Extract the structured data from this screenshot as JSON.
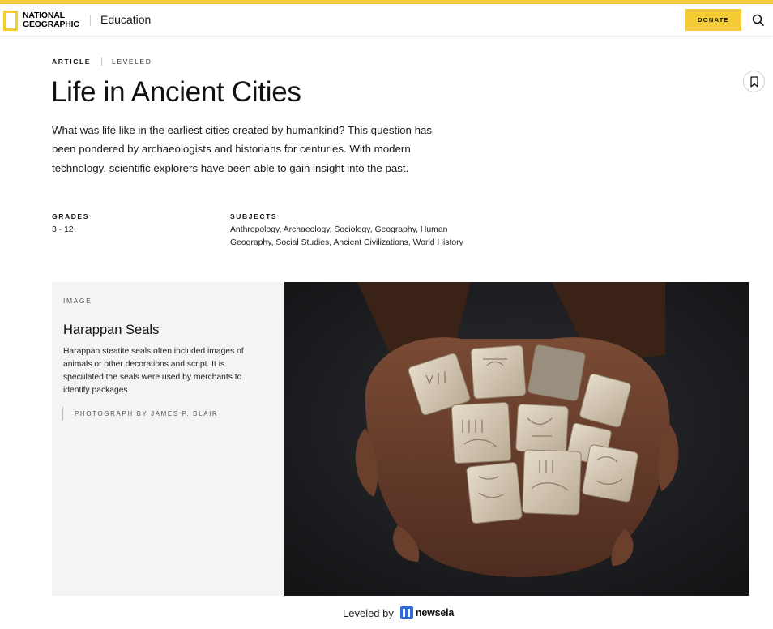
{
  "header": {
    "logo_line1": "NATIONAL",
    "logo_line2": "GEOGRAPHIC",
    "section": "Education",
    "donate_label": "DONATE",
    "accent_color": "#f4cc35"
  },
  "article": {
    "type": "ARTICLE",
    "level": "LEVELED",
    "title": "Life in Ancient Cities",
    "intro": "What was life like in the earliest cities created by humankind? This question has been pondered by archaeologists and historians for centuries. With modern technology, scientific explorers have been able to gain insight into the past.",
    "grades_label": "GRADES",
    "grades_value": "3 - 12",
    "subjects_label": "SUBJECTS",
    "subjects_value": "Anthropology, Archaeology, Sociology, Geography, Human Geography, Social Studies, Ancient Civilizations, World History"
  },
  "figure": {
    "kicker": "IMAGE",
    "title": "Harappan Seals",
    "description": "Harappan steatite seals often included images of animals or other decorations and script. It is speculated the seals were used by merchants to identify packages.",
    "credit": "PHOTOGRAPH BY JAMES P. BLAIR"
  },
  "footer": {
    "leveled_by": "Leveled by",
    "partner": "newsela"
  },
  "icons": {
    "search": "search-icon",
    "bookmark": "bookmark-icon",
    "logo": "yellow-border-logo-icon"
  }
}
